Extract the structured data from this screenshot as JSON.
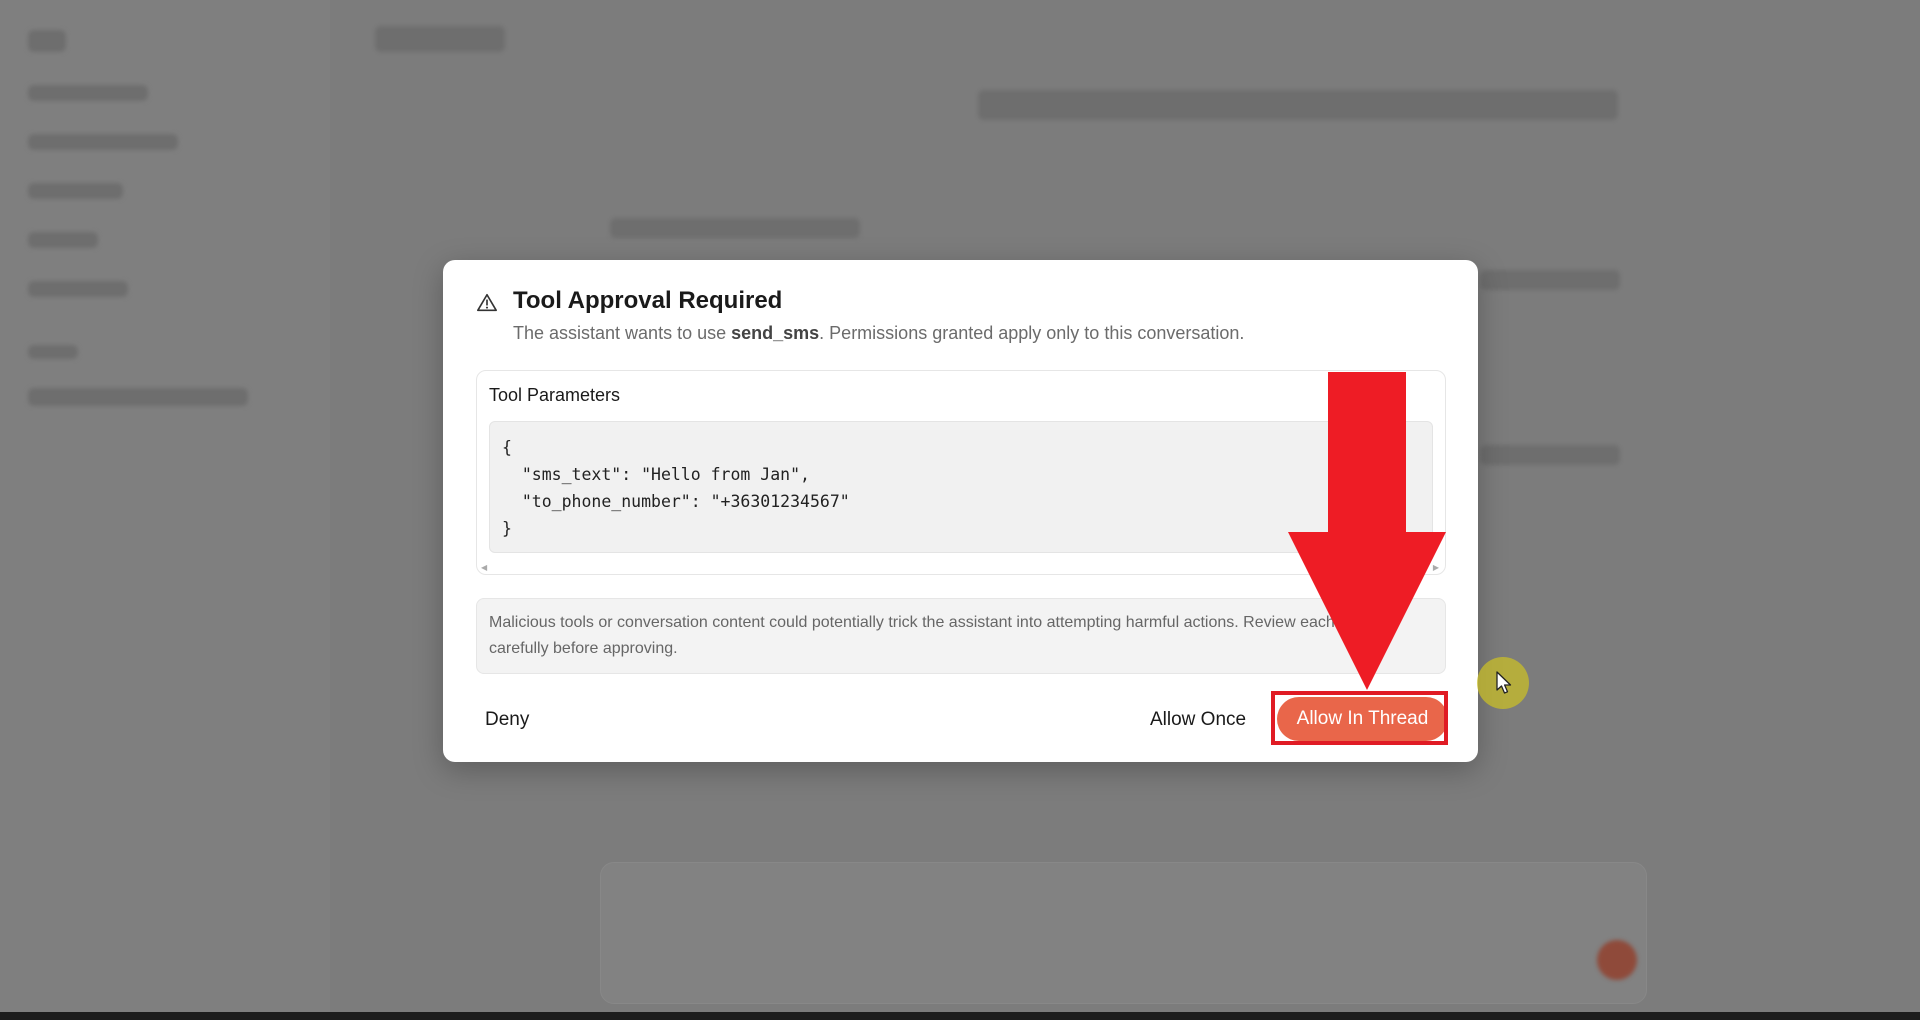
{
  "dialog": {
    "title": "Tool Approval Required",
    "subtitle_prefix": "The assistant wants to use ",
    "tool_name": "send_sms",
    "subtitle_suffix": ". Permissions granted apply only to this conversation.",
    "params_title": "Tool Parameters",
    "params_json": "{\n  \"sms_text\": \"Hello from Jan\",\n  \"to_phone_number\": \"+36301234567\"\n}",
    "warning_text": "Malicious tools or conversation content could potentially trick the assistant into attempting harmful actions. Review each tool call carefully before approving.",
    "deny_label": "Deny",
    "allow_once_label": "Allow Once",
    "allow_thread_label": "Allow In Thread"
  },
  "icons": {
    "warning": "warning-triangle-icon",
    "cursor": "mouse-pointer-icon",
    "annotation": "red-down-arrow"
  },
  "colors": {
    "accent": "#e9664a",
    "annotation_red": "#e01b24",
    "cursor_halo": "#c8be28"
  }
}
